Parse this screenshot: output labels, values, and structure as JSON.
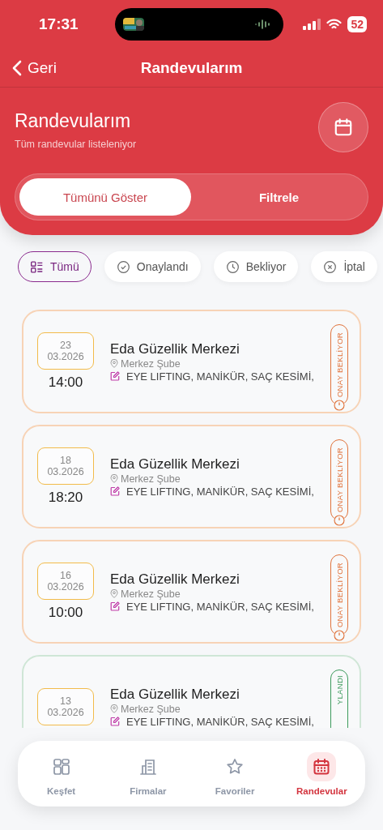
{
  "status_bar": {
    "time": "17:31",
    "battery": "52"
  },
  "nav_bar": {
    "back": "Geri",
    "title": "Randevularım"
  },
  "header": {
    "title": "Randevularım",
    "subtitle": "Tüm randevular listeleniyor"
  },
  "segments": [
    {
      "label": "Tümünü Göster",
      "selected": true
    },
    {
      "label": "Filtrele",
      "selected": false
    }
  ],
  "chips": [
    {
      "label": "Tümü",
      "kind": "all",
      "selected": true
    },
    {
      "label": "Onaylandı",
      "kind": "approved",
      "selected": false
    },
    {
      "label": "Bekliyor",
      "kind": "pending",
      "selected": false
    },
    {
      "label": "İptal",
      "kind": "cancelled",
      "selected": false
    }
  ],
  "appointments": [
    {
      "day": "23",
      "month": "03.2026",
      "time": "14:00",
      "business": "Eda Güzellik Merkezi",
      "branch": "Merkez Şube",
      "services": "EYE LIFTING, MANİKÜR, SAÇ KESİMİ,",
      "status": "ONAY BEKLİYOR",
      "kind": "pending"
    },
    {
      "day": "18",
      "month": "03.2026",
      "time": "18:20",
      "business": "Eda Güzellik Merkezi",
      "branch": "Merkez Şube",
      "services": "EYE LIFTING, MANİKÜR, SAÇ KESİMİ,",
      "status": "ONAY BEKLİYOR",
      "kind": "pending"
    },
    {
      "day": "16",
      "month": "03.2026",
      "time": "10:00",
      "business": "Eda Güzellik Merkezi",
      "branch": "Merkez Şube",
      "services": "EYE LIFTING, MANİKÜR, SAÇ KESİMİ,",
      "status": "ONAY BEKLİYOR",
      "kind": "pending"
    },
    {
      "day": "13",
      "month": "03.2026",
      "business": "Eda Güzellik Merkezi",
      "branch": "Merkez Şube",
      "services": "EYE LIFTING, MANİKÜR, SAÇ KESİMİ,",
      "status": "YLANDI",
      "kind": "approved"
    }
  ],
  "tab_bar": [
    {
      "label": "Keşfet",
      "kind": "grid",
      "selected": false
    },
    {
      "label": "Firmalar",
      "kind": "building",
      "selected": false
    },
    {
      "label": "Favoriler",
      "kind": "star",
      "selected": false
    },
    {
      "label": "Randevular",
      "kind": "calendar",
      "selected": true
    }
  ]
}
